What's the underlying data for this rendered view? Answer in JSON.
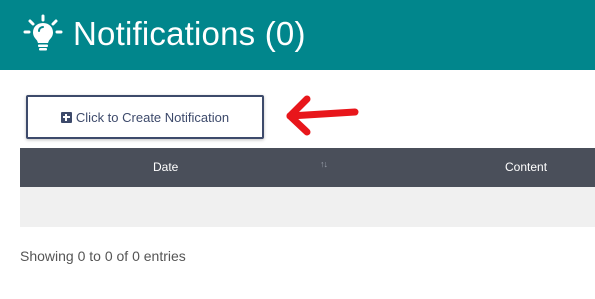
{
  "header": {
    "title": "Notifications (0)",
    "icon": "lightbulb-icon",
    "background_color": "#01868c"
  },
  "toolbar": {
    "create_label": "Click to Create Notification",
    "create_icon": "plus-square-icon"
  },
  "annotation": {
    "arrow_icon": "red-arrow-left-icon",
    "color": "#e8161b"
  },
  "table": {
    "columns": [
      {
        "label": "Date",
        "sort_icon": "sort-icon"
      },
      {
        "label": "Content"
      }
    ],
    "rows": []
  },
  "footer": {
    "info": "Showing 0 to 0 of 0 entries"
  }
}
